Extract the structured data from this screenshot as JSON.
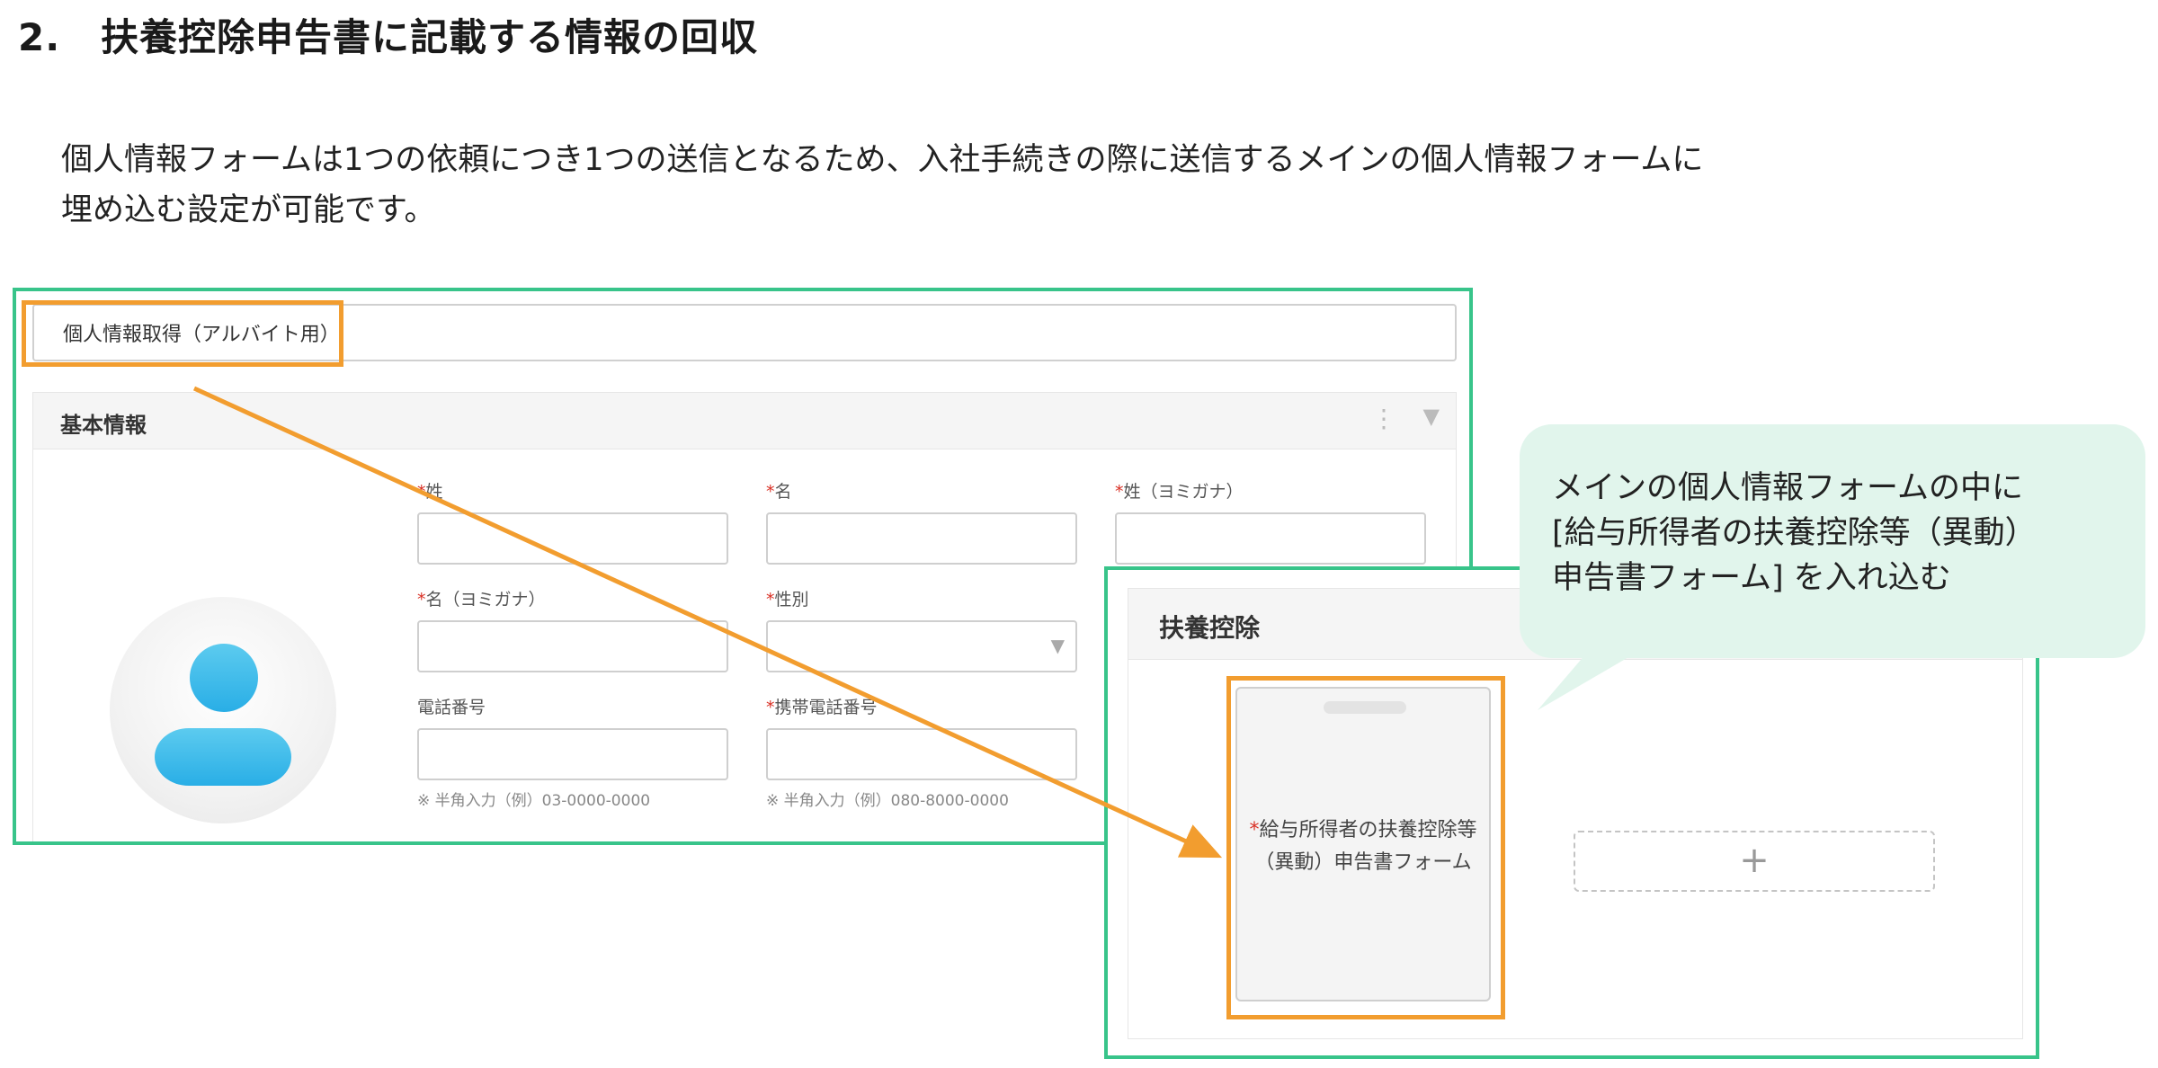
{
  "heading": {
    "number": "2.",
    "text": "扶養控除申告書に記載する情報の回収"
  },
  "intro": {
    "line1": "個人情報フォームは1つの依頼につき1つの送信となるため、入社手続きの際に送信するメインの個人情報フォームに",
    "line2": "埋め込む設定が可能です。"
  },
  "form_editor": {
    "form_title": "個人情報取得（アルバイト用）",
    "section_title": "基本情報",
    "section_menu_icon": "vertical-dots-icon",
    "section_collapse_icon": "triangle-down-icon",
    "avatar_icon": "person-avatar-icon",
    "fields": {
      "last_name": "姓",
      "first_name": "名",
      "last_name_kana": "姓（ヨミガナ）",
      "first_name_kana": "名（ヨミガナ）",
      "gender": "性別",
      "phone": "電話番号",
      "mobile": "携帯電話番号",
      "required_mark": "*"
    },
    "hints": {
      "phone": "※ 半角入力（例）03-0000-0000",
      "mobile": "※ 半角入力（例）080-8000-0000"
    }
  },
  "deduction_panel": {
    "section_title": "扶養控除",
    "embedded_form_line1": "給与所得者の扶養控除等",
    "embedded_form_line2": "（異動）申告書フォーム",
    "add_symbol": "+"
  },
  "callout": {
    "line1": "メインの個人情報フォームの中に",
    "line2": "[給与所得者の扶養控除等（異動）",
    "line3": "申告書フォーム] を入れ込む"
  },
  "colors": {
    "frame_green": "#38c48a",
    "highlight_orange": "#f29d2f",
    "callout_bg": "#e1f5ec",
    "required_red": "#d93025",
    "avatar_blue": "#29aee6"
  }
}
